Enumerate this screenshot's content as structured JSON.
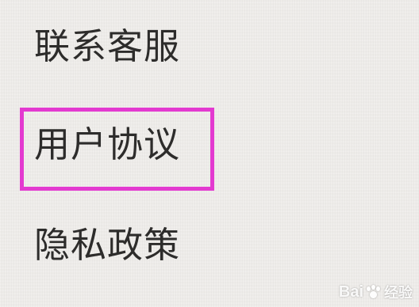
{
  "menu": {
    "items": [
      {
        "label": "联系客服"
      },
      {
        "label": "用户协议"
      },
      {
        "label": "隐私政策"
      }
    ],
    "highlighted_index": 1,
    "highlight_color": "#e33ad0"
  },
  "watermark": {
    "brand": "Bai",
    "suffix": "经验",
    "icon": "paw-icon"
  }
}
